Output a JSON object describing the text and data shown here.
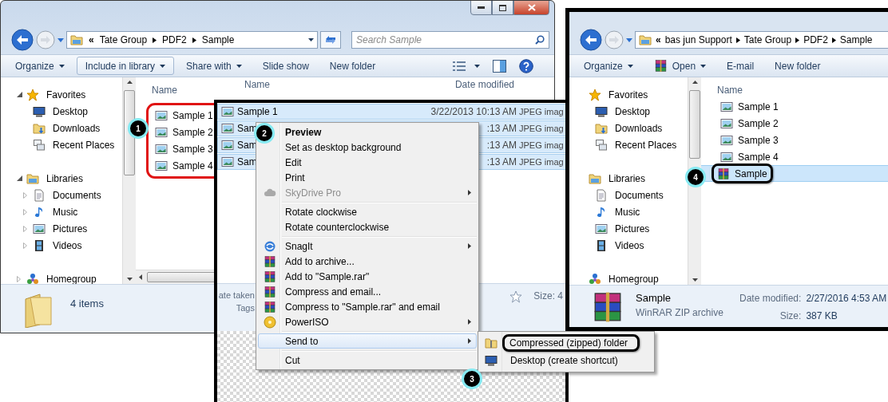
{
  "left_window": {
    "kind": "window",
    "breadcrumb_overflow": "«",
    "breadcrumb": [
      "Tate Group",
      "PDF2",
      "Sample"
    ],
    "search": {
      "placeholder": "Search Sample"
    },
    "toolbar": [
      {
        "label": "Organize",
        "kind": "text",
        "dropdown": true,
        "hovered": false
      },
      {
        "label": "Include in library",
        "kind": "text",
        "dropdown": true,
        "hovered": true
      },
      {
        "label": "Share with",
        "kind": "text",
        "dropdown": true,
        "hovered": false
      },
      {
        "label": "Slide show",
        "kind": "text",
        "dropdown": false,
        "hovered": false
      },
      {
        "label": "New folder",
        "kind": "text",
        "dropdown": false,
        "hovered": false
      }
    ],
    "nav": [
      {
        "label": "Favorites",
        "kind": "favorites",
        "expanded": true,
        "children": [
          {
            "label": "Desktop",
            "kind": "desktop"
          },
          {
            "label": "Downloads",
            "kind": "downloads"
          },
          {
            "label": "Recent Places",
            "kind": "recent"
          }
        ]
      },
      {
        "label": "Libraries",
        "kind": "libraries",
        "expanded": true,
        "children": [
          {
            "label": "Documents",
            "kind": "documents",
            "expanded": false
          },
          {
            "label": "Music",
            "kind": "music",
            "expanded": false
          },
          {
            "label": "Pictures",
            "kind": "pictures",
            "expanded": false
          },
          {
            "label": "Videos",
            "kind": "videos",
            "expanded": false
          }
        ]
      },
      {
        "label": "Homegroup",
        "kind": "homegroup",
        "expanded": false
      }
    ],
    "list_header": "Name",
    "files_outlined": true,
    "files": [
      {
        "name": "Sample 1",
        "kind": "image",
        "selected": false,
        "outlined": false
      },
      {
        "name": "Sample 2",
        "kind": "image",
        "selected": false,
        "outlined": false
      },
      {
        "name": "Sample 3",
        "kind": "image",
        "selected": false,
        "outlined": false
      },
      {
        "name": "Sample 4",
        "kind": "image",
        "selected": false,
        "outlined": false
      }
    ],
    "status": {
      "kind": "summary",
      "text": "4 items"
    }
  },
  "middle_panel": {
    "column_headers": [
      "Name",
      "Date modified"
    ],
    "rows": [
      {
        "name": "Sample 1",
        "date": "3/22/2013 10:13 AM",
        "type": "JPEG imag",
        "selected": true
      },
      {
        "name": "Sam",
        "date": ":13 AM",
        "type": "JPEG imag",
        "selected": true
      },
      {
        "name": "Sam",
        "date": ":13 AM",
        "type": "JPEG imag",
        "selected": true
      },
      {
        "name": "Sam",
        "date": ":13 AM",
        "type": "JPEG imag",
        "selected": true
      }
    ],
    "details": {
      "date_label": "ate taken",
      "tags_label": "Tags",
      "size_label": "Size: 4"
    }
  },
  "context_menu": {
    "items": [
      {
        "kind": "item",
        "label": "Preview",
        "default": true,
        "disabled": false,
        "submenu": false,
        "selected": false
      },
      {
        "kind": "item",
        "label": "Set as desktop background",
        "default": false,
        "disabled": false,
        "submenu": false,
        "selected": false
      },
      {
        "kind": "item",
        "label": "Edit",
        "default": false,
        "disabled": false,
        "submenu": false,
        "selected": false
      },
      {
        "kind": "item",
        "label": "Print",
        "default": false,
        "disabled": false,
        "submenu": false,
        "selected": false
      },
      {
        "kind": "cloud-item",
        "label": "SkyDrive Pro",
        "default": false,
        "disabled": true,
        "submenu": true,
        "selected": false
      },
      {
        "kind": "separator"
      },
      {
        "kind": "item",
        "label": "Rotate clockwise",
        "default": false,
        "disabled": false,
        "submenu": false,
        "selected": false
      },
      {
        "kind": "item",
        "label": "Rotate counterclockwise",
        "default": false,
        "disabled": false,
        "submenu": false,
        "selected": false
      },
      {
        "kind": "separator"
      },
      {
        "kind": "swirl-item",
        "label": "SnagIt",
        "default": false,
        "disabled": false,
        "submenu": true,
        "selected": false
      },
      {
        "kind": "archive-item",
        "label": "Add to archive...",
        "default": false,
        "disabled": false,
        "submenu": false,
        "selected": false
      },
      {
        "kind": "archive-item",
        "label": "Add to \"Sample.rar\"",
        "default": false,
        "disabled": false,
        "submenu": false,
        "selected": false
      },
      {
        "kind": "archive-item",
        "label": "Compress and email...",
        "default": false,
        "disabled": false,
        "submenu": false,
        "selected": false
      },
      {
        "kind": "archive-item",
        "label": "Compress to \"Sample.rar\" and email",
        "default": false,
        "disabled": false,
        "submenu": false,
        "selected": false
      },
      {
        "kind": "disc-item",
        "label": "PowerISO",
        "default": false,
        "disabled": false,
        "submenu": true,
        "selected": false
      },
      {
        "kind": "separator"
      },
      {
        "kind": "item",
        "label": "Send to",
        "default": false,
        "disabled": false,
        "submenu": true,
        "selected": true
      },
      {
        "kind": "separator"
      },
      {
        "kind": "item",
        "label": "Cut",
        "default": false,
        "disabled": false,
        "submenu": false,
        "selected": false
      }
    ],
    "submenu": [
      {
        "kind": "zip-item",
        "label": "Compressed (zipped) folder",
        "outlined": true
      },
      {
        "kind": "desktop-item",
        "label": "Desktop (create shortcut)",
        "outlined": false
      }
    ]
  },
  "right_window": {
    "kind": "cropped",
    "breadcrumb_overflow": "«",
    "breadcrumb": [
      "bas jun Support",
      "Tate Group",
      "PDF2",
      "Sample"
    ],
    "toolbar": [
      {
        "label": "Organize",
        "kind": "text",
        "dropdown": true,
        "hovered": false
      },
      {
        "label": "Open",
        "kind": "archive",
        "dropdown": true,
        "hovered": false
      },
      {
        "label": "E-mail",
        "kind": "text",
        "dropdown": false,
        "hovered": false
      },
      {
        "label": "New folder",
        "kind": "text",
        "dropdown": false,
        "hovered": false
      }
    ],
    "nav": [
      {
        "label": "Favorites",
        "kind": "favorites",
        "children": [
          {
            "label": "Desktop",
            "kind": "desktop"
          },
          {
            "label": "Downloads",
            "kind": "downloads"
          },
          {
            "label": "Recent Places",
            "kind": "recent"
          }
        ]
      },
      {
        "label": "Libraries",
        "kind": "libraries",
        "children": [
          {
            "label": "Documents",
            "kind": "documents"
          },
          {
            "label": "Music",
            "kind": "music"
          },
          {
            "label": "Pictures",
            "kind": "pictures"
          },
          {
            "label": "Videos",
            "kind": "videos"
          }
        ]
      },
      {
        "label": "Homegroup",
        "kind": "homegroup"
      }
    ],
    "list_header": "Name",
    "files_outlined": false,
    "files": [
      {
        "name": "Sample 1",
        "kind": "image",
        "selected": false,
        "outlined": false
      },
      {
        "name": "Sample 2",
        "kind": "image",
        "selected": false,
        "outlined": false
      },
      {
        "name": "Sample 3",
        "kind": "image",
        "selected": false,
        "outlined": false
      },
      {
        "name": "Sample 4",
        "kind": "image",
        "selected": false,
        "outlined": false
      },
      {
        "name": "Sample",
        "kind": "archive",
        "selected": true,
        "outlined": true
      }
    ],
    "status": {
      "kind": "file",
      "name": "Sample",
      "type": "WinRAR ZIP archive",
      "fields": [
        {
          "label": "Date modified:",
          "value": "2/27/2016 4:53 AM"
        },
        {
          "label": "Size:",
          "value": "387 KB"
        }
      ]
    }
  },
  "callouts": [
    {
      "number": "1"
    },
    {
      "number": "2"
    },
    {
      "number": "3"
    },
    {
      "number": "4"
    }
  ]
}
